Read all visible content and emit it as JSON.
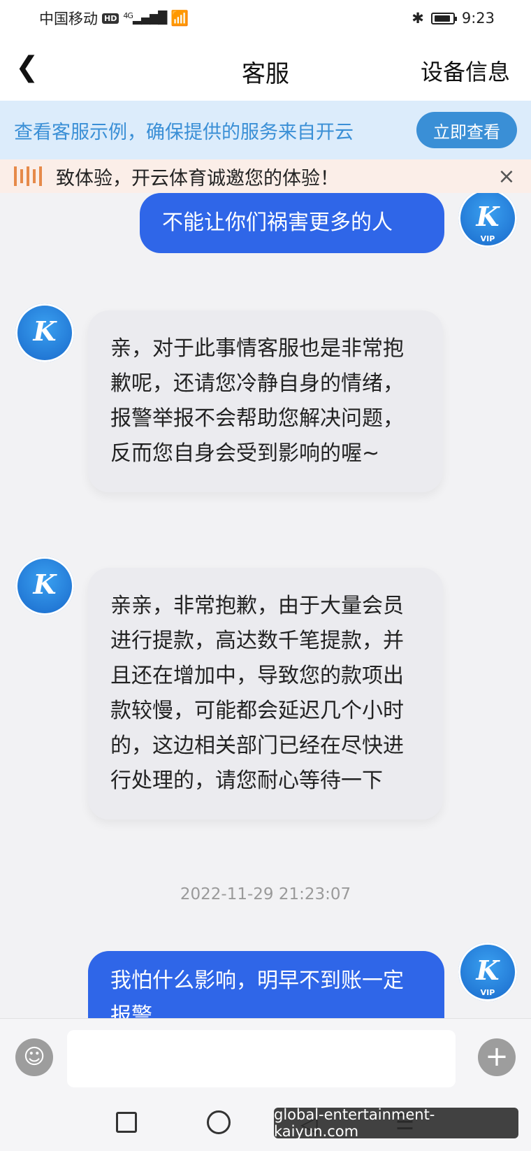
{
  "status_bar": {
    "carrier": "中国移动",
    "hd": "HD",
    "network": "4G",
    "time": "9:23"
  },
  "nav": {
    "back_icon": "chevron-left-icon",
    "title": "客服",
    "right_label": "设备信息"
  },
  "banner": {
    "text": "查看客服示例，确保提供的服务来自开云",
    "button_label": "立即查看"
  },
  "notice": {
    "text": "致体验，开云体育诚邀您的体验！",
    "close_glyph": "×"
  },
  "avatar": {
    "text": "K",
    "badge": "VIP"
  },
  "messages": [
    {
      "direction": "out",
      "text": "不能让你们祸害更多的人"
    },
    {
      "direction": "in",
      "text": "亲，对于此事情客服也是非常抱歉呢，还请您冷静自身的情绪，报警举报不会帮助您解决问题，反而您自身会受到影响的喔~"
    },
    {
      "direction": "in",
      "text": "亲亲，非常抱歉，由于大量会员进行提款，高达数千笔提款，并且还在增加中，导致您的款项出款较慢，可能都会延迟几个小时的，这边相关部门已经在尽快进行处理的，请您耐心等待一下"
    },
    {
      "direction": "out",
      "text": "我怕什么影响，明早不到账一定报警"
    }
  ],
  "timestamp": "2022-11-29 21:23:07",
  "input": {
    "placeholder": ""
  },
  "watermark": "global-entertainment-kaiyun.com",
  "colors": {
    "accent": "#3a8fd6",
    "out_bubble": "#2f66e8",
    "in_bubble": "#ebebef"
  }
}
